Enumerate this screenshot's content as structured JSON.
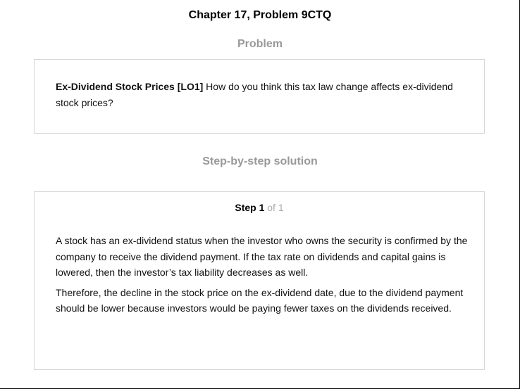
{
  "page": {
    "title": "Chapter 17, Problem 9CTQ"
  },
  "problem": {
    "heading": "Problem",
    "label": "Ex-Dividend Stock Prices [LO1]",
    "text": " How do you think this tax law change affects ex-dividend stock prices?"
  },
  "solution": {
    "heading": "Step-by-step solution",
    "step_word": "Step 1",
    "step_of": " of 1",
    "paragraphs": [
      "A stock has an ex-dividend status when the investor who owns the security is confirmed by the company to receive the dividend payment. If the tax rate on dividends and capital gains is lowered, then the investor’s tax liability decreases as well.",
      "Therefore, the decline in the stock price on the ex-dividend date, due to the dividend payment should be lower because investors would be paying fewer taxes on the dividends received."
    ]
  },
  "colors": {
    "heading_gray": "#999999",
    "card_border": "#d6d6d6",
    "step_of_gray": "#aaaaaa"
  }
}
